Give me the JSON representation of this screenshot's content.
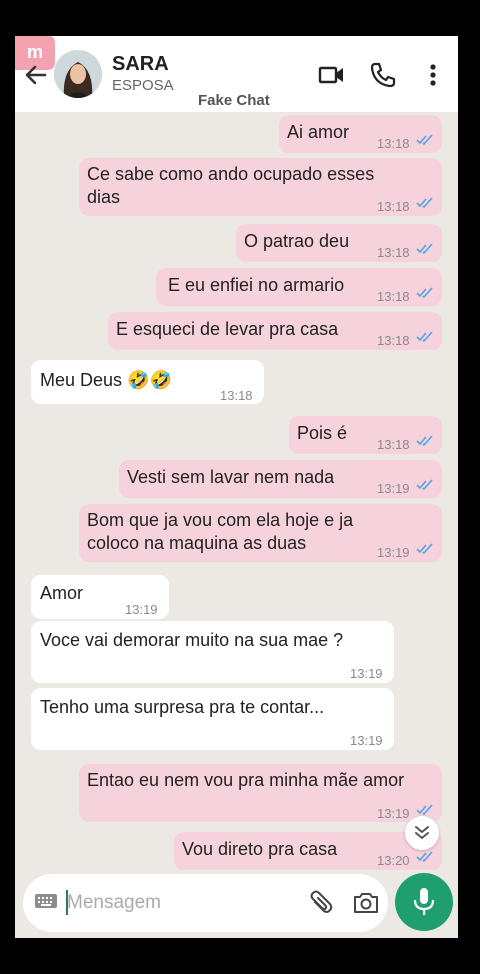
{
  "header": {
    "contact_name": "SARA",
    "contact_status": "ESPOSA",
    "watermark": "Fake Chat",
    "icons": [
      "back-arrow-icon",
      "video-call-icon",
      "phone-icon",
      "more-options-icon"
    ]
  },
  "messages": [
    {
      "direction": "out",
      "lines": [
        "Ai amor"
      ],
      "time": "13:18",
      "read": true
    },
    {
      "direction": "out",
      "lines": [
        "Ce sabe como ando ocupado esses",
        "dias"
      ],
      "time": "13:18",
      "read": true
    },
    {
      "direction": "out",
      "lines": [
        "O patrao deu"
      ],
      "time": "13:18",
      "read": true
    },
    {
      "direction": "out",
      "lines": [
        "E eu enfiei no armario"
      ],
      "time": "13:18",
      "read": true
    },
    {
      "direction": "out",
      "lines": [
        "E esqueci de levar pra casa"
      ],
      "time": "13:18",
      "read": true
    },
    {
      "direction": "in",
      "lines": [
        "Meu Deus 🤣🤣"
      ],
      "time": "13:18"
    },
    {
      "direction": "out",
      "lines": [
        "Pois é"
      ],
      "time": "13:18",
      "read": true
    },
    {
      "direction": "out",
      "lines": [
        "Vesti sem lavar nem nada"
      ],
      "time": "13:19",
      "read": true
    },
    {
      "direction": "out",
      "lines": [
        "Bom que ja vou com ela hoje e ja",
        "coloco na maquina as duas"
      ],
      "time": "13:19",
      "read": true
    },
    {
      "direction": "in",
      "lines": [
        "Amor"
      ],
      "time": "13:19"
    },
    {
      "direction": "in",
      "lines": [
        "Voce vai demorar muito na sua mae ?"
      ],
      "time": "13:19"
    },
    {
      "direction": "in",
      "lines": [
        "Tenho uma surpresa pra te contar..."
      ],
      "time": "13:19"
    },
    {
      "direction": "out",
      "lines": [
        "Entao eu nem vou pra minha mãe amor"
      ],
      "time": "13:19",
      "read": true
    },
    {
      "direction": "out",
      "lines": [
        "Vou direto pra casa"
      ],
      "time": "13:20",
      "read": true
    }
  ],
  "composer": {
    "placeholder": "Mensagem",
    "icons": [
      "keyboard-icon",
      "attach-icon",
      "camera-icon",
      "mic-icon"
    ]
  },
  "colors": {
    "outgoing_bubble": "#f6d3dc",
    "incoming_bubble": "#ffffff",
    "read_tick": "#4fa3e6",
    "mic_button": "#1f9e6f",
    "chat_background": "#ece9e4"
  }
}
